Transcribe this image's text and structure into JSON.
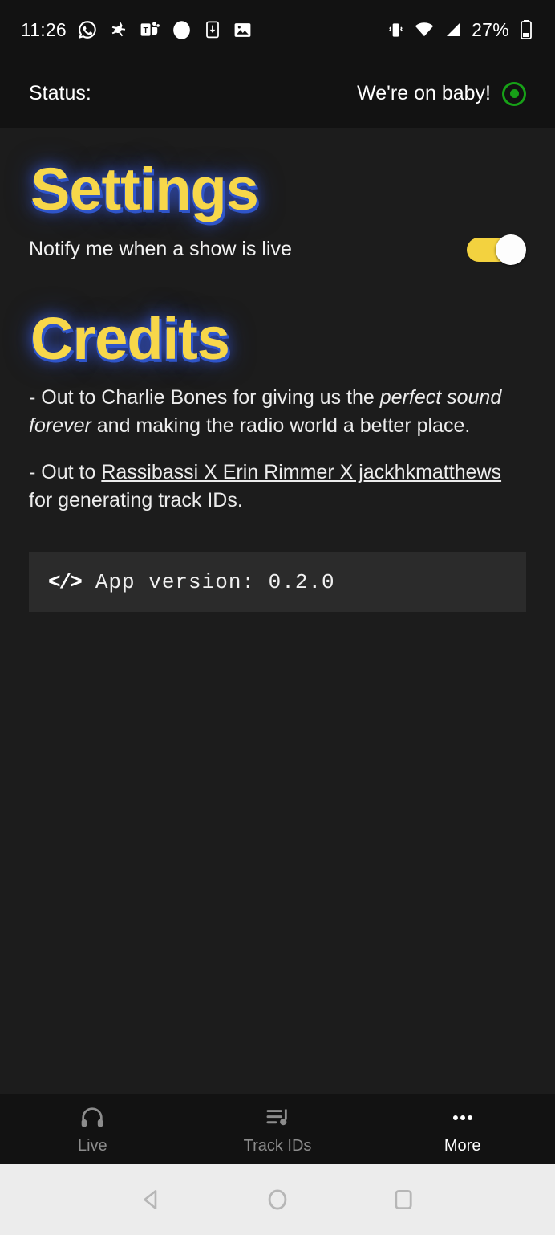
{
  "status_bar": {
    "clock": "11:26",
    "battery_percent": "27%",
    "left_icons": [
      "whatsapp-icon",
      "app-notification-icon",
      "microsoft-teams-icon",
      "circle-notification-icon",
      "download-icon",
      "gallery-image-icon"
    ],
    "right_icons": [
      "vibrate-icon",
      "wifi-icon",
      "cellular-signal-icon",
      "battery-icon"
    ]
  },
  "app_header": {
    "label": "Status:",
    "status_text": "We're on baby!",
    "indicator_icon": "live-dot-icon",
    "indicator_color": "#17a117"
  },
  "settings": {
    "heading": "Settings",
    "notify_label": "Notify me when a show is live",
    "notify_enabled": true,
    "toggle_on_color": "#f3d23f",
    "toggle_thumb_color": "#fdfdfd"
  },
  "credits": {
    "heading": "Credits",
    "entry_1": {
      "prefix": "- Out to Charlie Bones for giving us the ",
      "italic": "perfect sound forever",
      "suffix": " and making the radio world a better place."
    },
    "entry_2": {
      "prefix": "- Out to ",
      "link": "Rassibassi X Erin Rimmer X jackhkmatthews",
      "suffix": " for generating track IDs."
    }
  },
  "version_box": {
    "icon": "code-brackets-icon",
    "text": "App version: 0.2.0"
  },
  "tab_bar": {
    "tabs": [
      {
        "label": "Live",
        "icon": "headphones-icon",
        "active": false
      },
      {
        "label": "Track IDs",
        "icon": "queue-music-icon",
        "active": false
      },
      {
        "label": "More",
        "icon": "more-dots-icon",
        "active": true
      }
    ]
  },
  "android_nav": {
    "buttons": [
      {
        "name": "back-icon"
      },
      {
        "name": "home-icon"
      },
      {
        "name": "recents-icon"
      }
    ]
  },
  "theme": {
    "accent_yellow": "#f7d74a",
    "glow_blue": "#2f55c9",
    "bg": "#1c1c1c",
    "bar_bg": "#121212"
  }
}
